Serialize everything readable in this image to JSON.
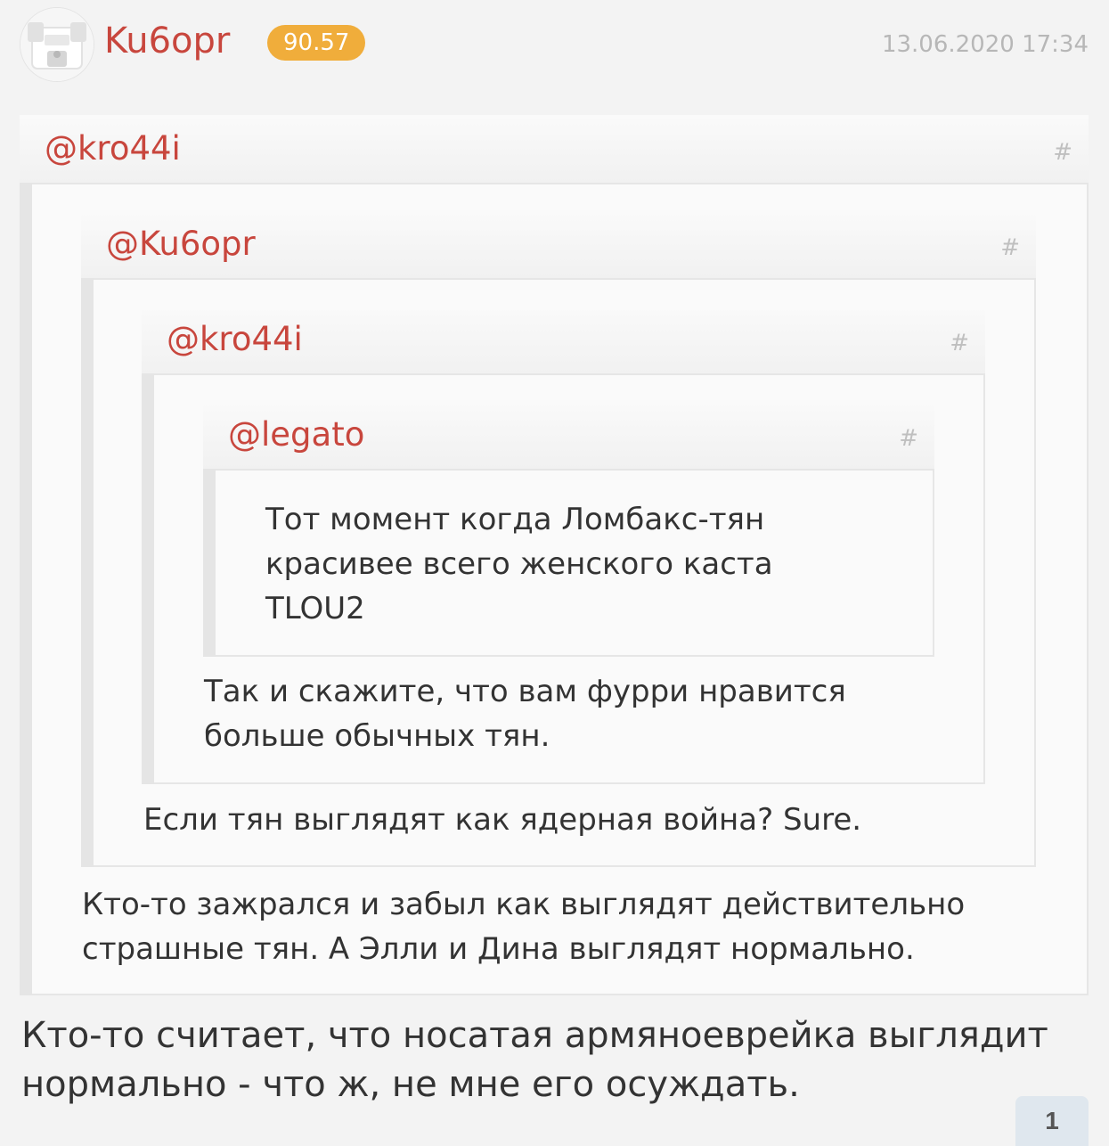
{
  "post": {
    "username": "Ku6opr",
    "rating": "90.57",
    "timestamp": "13.06.2020 17:34",
    "text_lines": [
      "Кто-то считает, что носатая армяноеврейка выглядит",
      "нормально - что ж, не мне его осуждать."
    ],
    "likes": "1"
  },
  "quotes": [
    {
      "author": "@kro44i",
      "hash": "#",
      "lines": [
        "Кто-то зажрался и забыл как выглядят действительно",
        "страшные тян. А Элли и Дина выглядят нормально."
      ]
    },
    {
      "author": "@Ku6opr",
      "hash": "#",
      "lines": [
        "Если тян выглядят как ядерная война? Sure."
      ]
    },
    {
      "author": "@kro44i",
      "hash": "#",
      "lines": [
        "Так и скажите, что вам фурри нравится",
        "больше обычных тян."
      ]
    },
    {
      "author": "@legato",
      "hash": "#",
      "lines": [
        "Тот момент когда Ломбакс-тян",
        "красивее всего женского каста",
        "TLOU2"
      ]
    }
  ]
}
